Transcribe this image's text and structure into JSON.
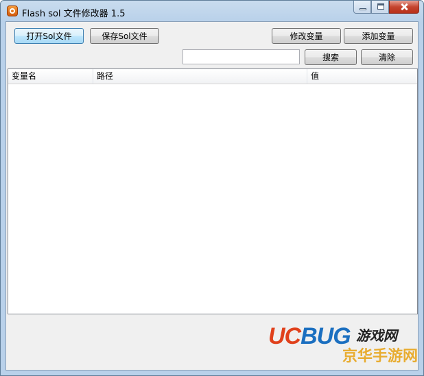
{
  "window": {
    "title": "Flash sol 文件修改器 1.5"
  },
  "toolbar": {
    "open_label": "打开Sol文件",
    "save_label": "保存Sol文件",
    "modify_label": "修改变量",
    "add_label": "添加变量",
    "search_label": "搜索",
    "clear_label": "清除"
  },
  "search": {
    "value": "",
    "placeholder": ""
  },
  "table": {
    "columns": [
      "变量名",
      "路径",
      "值"
    ],
    "rows": []
  },
  "watermark": {
    "brand_uc": "UC",
    "brand_bug": "BUG",
    "brand_game": "游戏网",
    "site_name": "京华手游网"
  },
  "colors": {
    "title_bar": "#b9d1ea",
    "close_button": "#c5452f",
    "focused_button": "#bee6fd",
    "client_bg": "#f0f0f0"
  },
  "icons": [
    "app-icon",
    "minimize-icon",
    "maximize-icon",
    "close-icon"
  ]
}
